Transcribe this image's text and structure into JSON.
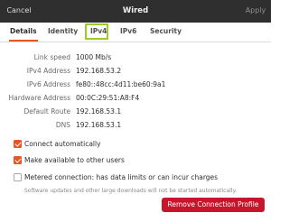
{
  "titlebar": {
    "cancel_label": "Cancel",
    "title": "Wired",
    "apply_label": "Apply"
  },
  "tabs": [
    {
      "label": "Details"
    },
    {
      "label": "Identity"
    },
    {
      "label": "IPv4"
    },
    {
      "label": "IPv6"
    },
    {
      "label": "Security"
    }
  ],
  "details": [
    {
      "label": "Link speed",
      "value": "1000 Mb/s"
    },
    {
      "label": "IPv4 Address",
      "value": "192.168.53.2"
    },
    {
      "label": "IPv6 Address",
      "value": "fe80::48cc:4d11:be60:9a1"
    },
    {
      "label": "Hardware Address",
      "value": "00:0C:29:51:A8:F4"
    },
    {
      "label": "Default Route",
      "value": "192.168.53.1"
    },
    {
      "label": "DNS",
      "value": "192.168.53.1"
    }
  ],
  "options": {
    "connect_auto": {
      "label": "Connect automatically",
      "checked": true
    },
    "available_all": {
      "label": "Make available to other users",
      "checked": true
    },
    "metered": {
      "label": "Metered connection: has data limits or can incur charges",
      "checked": false,
      "note": "Software updates and other large downloads will not be started automatically."
    }
  },
  "remove_button_label": "Remove Connection Profile",
  "colors": {
    "accent": "#e95420",
    "danger": "#c7162b",
    "highlight": "#9ccc2a",
    "titlebar": "#2f2f2f"
  }
}
